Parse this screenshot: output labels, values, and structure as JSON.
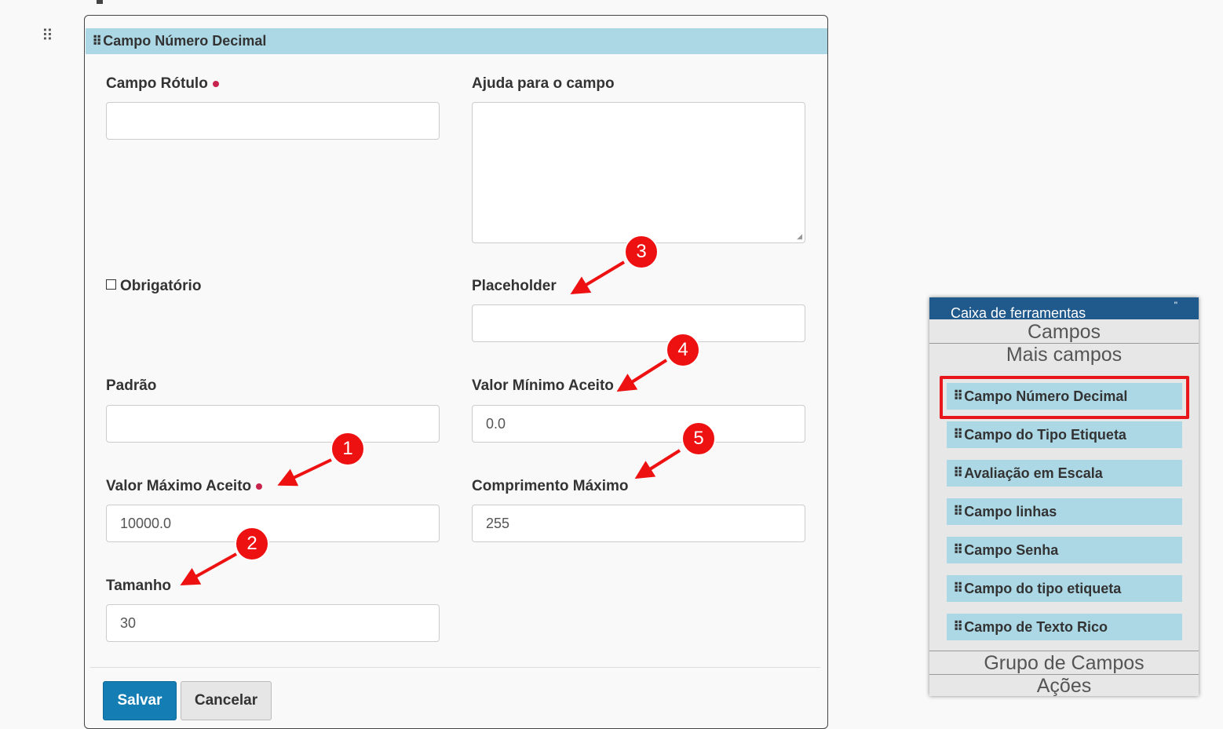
{
  "form": {
    "title": "Campo Número Decimal",
    "fields": {
      "campo_rotulo": {
        "label": "Campo Rótulo",
        "value": ""
      },
      "ajuda": {
        "label": "Ajuda para o campo",
        "value": ""
      },
      "obrigatorio": {
        "label": "Obrigatório",
        "checked": false
      },
      "placeholder": {
        "label": "Placeholder",
        "value": ""
      },
      "padrao": {
        "label": "Padrão",
        "value": ""
      },
      "valor_minimo": {
        "label": "Valor Mínimo Aceito",
        "value": "0.0"
      },
      "valor_maximo": {
        "label": "Valor Máximo Aceito",
        "value": "10000.0"
      },
      "comprimento_maximo": {
        "label": "Comprimento Máximo",
        "value": "255"
      },
      "tamanho": {
        "label": "Tamanho",
        "value": "30"
      }
    },
    "buttons": {
      "save": "Salvar",
      "cancel": "Cancelar"
    }
  },
  "annotations": {
    "badges": [
      "1",
      "2",
      "3",
      "4",
      "5"
    ],
    "color": "#ee1111"
  },
  "toolbox": {
    "title": "Caixa de ferramentas",
    "close_glyph": "\"",
    "sections": {
      "campos": "Campos",
      "mais_campos": "Mais campos",
      "grupo": "Grupo de Campos",
      "acoes": "Ações"
    },
    "items": [
      "Campo Número Decimal",
      "Campo do Tipo Etiqueta",
      "Avaliação em Escala",
      "Campo linhas",
      "Campo Senha",
      "Campo do tipo etiqueta",
      "Campo de Texto Rico"
    ],
    "highlighted_item": "Campo Número Decimal"
  },
  "colors": {
    "header": "#acd8e6",
    "toolbox_title": "#205a8c",
    "save_button": "#137db4",
    "required_dot": "#c7254e",
    "highlight": "#e8151b"
  }
}
